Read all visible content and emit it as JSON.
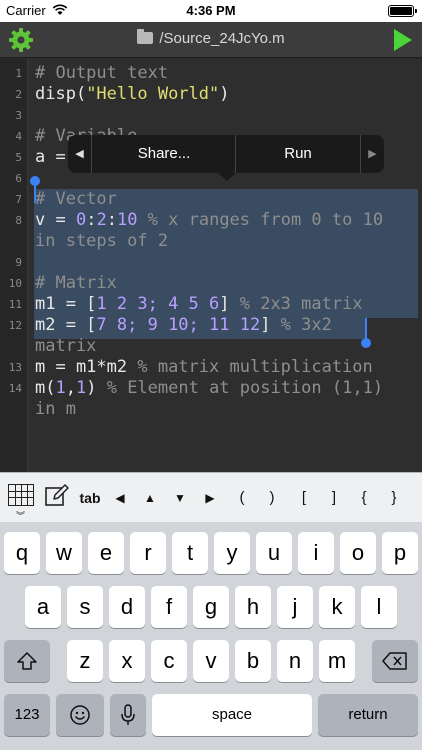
{
  "status_bar": {
    "carrier": "Carrier",
    "time": "4:36 PM"
  },
  "nav": {
    "title": "/Source_24JcYo.m",
    "settings_icon": "gear-icon",
    "run_icon": "play-icon",
    "colors": {
      "settings": "#5ec23a",
      "run": "#4cd43b"
    }
  },
  "editor": {
    "line_numbers": [
      "1",
      "2",
      "3",
      "4",
      "5",
      "6",
      "7",
      "8",
      "9",
      "10",
      "11",
      "12",
      "13",
      "14"
    ],
    "lines": {
      "l1": "# Output text",
      "l2_a": "disp(",
      "l2_str": "\"Hello World\"",
      "l2_b": ")",
      "l4": "# Variable",
      "l5": "a = ",
      "l7": "# Vector",
      "l8_a": "v = ",
      "l8_n1": "0",
      "l8_c1": ":",
      "l8_n2": "2",
      "l8_c2": ":",
      "l8_n3": "10",
      "l8_cmt": " % x ranges from 0 to 10",
      "l8_wrap": "in steps of 2",
      "l10": "# Matrix",
      "l11_a": "m1 = [",
      "l11_n": "1 2 3; 4 5 6",
      "l11_b": "]",
      "l11_cmt": " % 2x3 matrix",
      "l12_a": "m2 = [",
      "l12_n": "7 8; 9 10; 11 12",
      "l12_b": "]",
      "l12_cmt": " % 3x2",
      "l12_wrap": "matrix",
      "l13_a": "m = m1*m2",
      "l13_cmt": " % matrix multiplication",
      "l14_a": "m(",
      "l14_n1": "1",
      "l14_c": ",",
      "l14_n2": "1",
      "l14_b": ")",
      "l14_cmt": " % Element at position (1,1)",
      "l14_wrap": "in m"
    }
  },
  "context_menu": {
    "share": "Share...",
    "run": "Run"
  },
  "keyboard_toolbar": {
    "tab": "tab",
    "arrows": [
      "◀",
      "▲",
      "▼",
      "▶"
    ],
    "brackets": [
      "(",
      ")",
      "[",
      "]",
      "{",
      "}"
    ]
  },
  "keyboard": {
    "row1": [
      "q",
      "w",
      "e",
      "r",
      "t",
      "y",
      "u",
      "i",
      "o",
      "p"
    ],
    "row2": [
      "a",
      "s",
      "d",
      "f",
      "g",
      "h",
      "j",
      "k",
      "l"
    ],
    "row3": [
      "z",
      "x",
      "c",
      "v",
      "b",
      "n",
      "m"
    ],
    "numbers_key": "123",
    "space": "space",
    "return": "return",
    "shift_icon": "shift-icon",
    "delete_icon": "backspace-icon",
    "emoji_icon": "emoji-icon",
    "mic_icon": "microphone-icon"
  }
}
